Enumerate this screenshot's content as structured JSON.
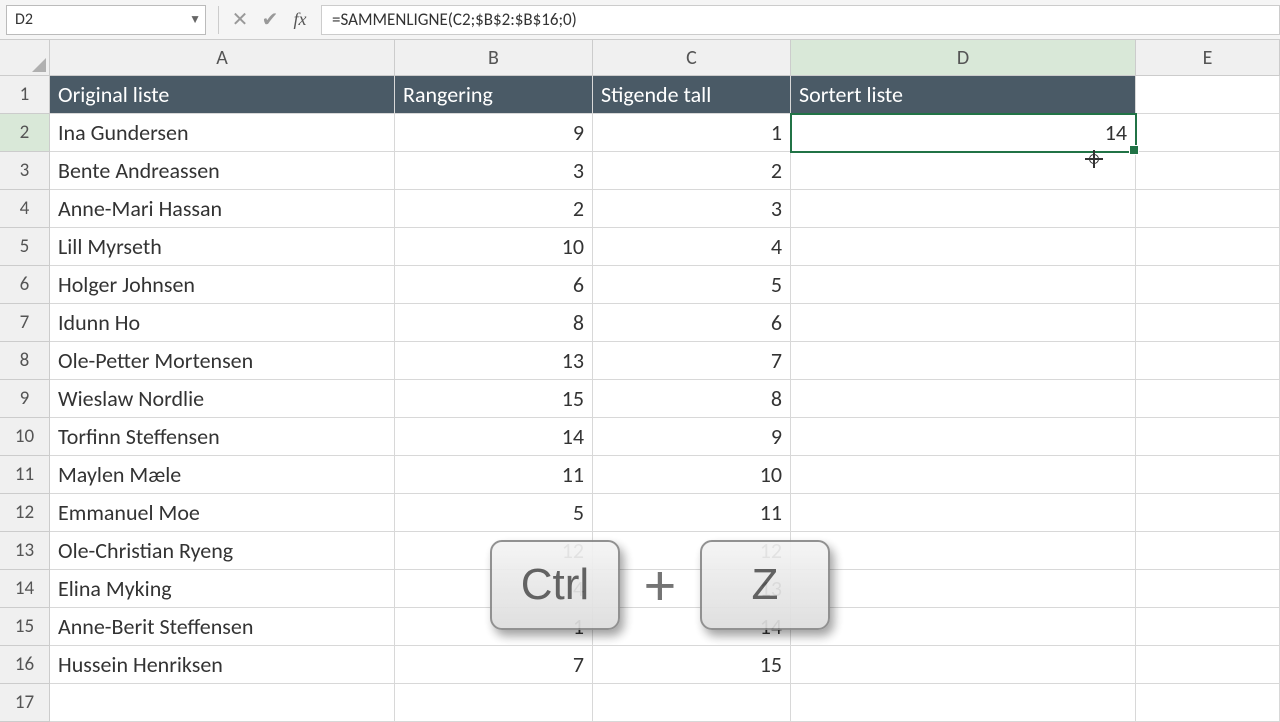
{
  "nameBox": "D2",
  "formula": "=SAMMENLIGNE(C2;$B$2:$B$16;0)",
  "columns": [
    "A",
    "B",
    "C",
    "D",
    "E"
  ],
  "activeCol": "D",
  "activeRow": 2,
  "headerRow": {
    "A": "Original liste",
    "B": "Rangering",
    "C": "Stigende tall",
    "D": "Sortert liste"
  },
  "rows": [
    {
      "n": 2,
      "A": "Ina Gundersen",
      "B": "9",
      "C": "1",
      "D": "14"
    },
    {
      "n": 3,
      "A": "Bente Andreassen",
      "B": "3",
      "C": "2",
      "D": ""
    },
    {
      "n": 4,
      "A": "Anne-Mari Hassan",
      "B": "2",
      "C": "3",
      "D": ""
    },
    {
      "n": 5,
      "A": "Lill Myrseth",
      "B": "10",
      "C": "4",
      "D": ""
    },
    {
      "n": 6,
      "A": "Holger Johnsen",
      "B": "6",
      "C": "5",
      "D": ""
    },
    {
      "n": 7,
      "A": "Idunn Ho",
      "B": "8",
      "C": "6",
      "D": ""
    },
    {
      "n": 8,
      "A": "Ole-Petter Mortensen",
      "B": "13",
      "C": "7",
      "D": ""
    },
    {
      "n": 9,
      "A": "Wieslaw Nordlie",
      "B": "15",
      "C": "8",
      "D": ""
    },
    {
      "n": 10,
      "A": "Torfinn Steffensen",
      "B": "14",
      "C": "9",
      "D": ""
    },
    {
      "n": 11,
      "A": "Maylen Mæle",
      "B": "11",
      "C": "10",
      "D": ""
    },
    {
      "n": 12,
      "A": "Emmanuel Moe",
      "B": "5",
      "C": "11",
      "D": ""
    },
    {
      "n": 13,
      "A": "Ole-Christian Ryeng",
      "B": "12",
      "C": "12",
      "D": ""
    },
    {
      "n": 14,
      "A": "Elina Myking",
      "B": "4",
      "C": "13",
      "D": ""
    },
    {
      "n": 15,
      "A": "Anne-Berit Steffensen",
      "B": "1",
      "C": "14",
      "D": ""
    },
    {
      "n": 16,
      "A": "Hussein Henriksen",
      "B": "7",
      "C": "15",
      "D": ""
    },
    {
      "n": 17,
      "A": "",
      "B": "",
      "C": "",
      "D": ""
    }
  ],
  "shortcut": {
    "key1": "Ctrl",
    "sep": "+",
    "key2": "Z"
  }
}
